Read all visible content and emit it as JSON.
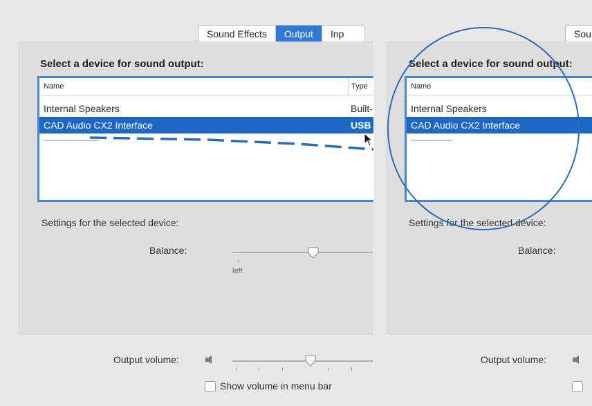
{
  "tabs": {
    "sound_effects": "Sound Effects",
    "output": "Output",
    "input_truncated": "Inp",
    "sound_truncated": "Sou"
  },
  "output_panel": {
    "heading": "Select a device for sound output:",
    "heading_right": "Select a device for sound output:",
    "columns": {
      "name": "Name",
      "type": "Type"
    },
    "devices": [
      {
        "name": "Internal Speakers",
        "type": "Built-"
      },
      {
        "name": "CAD Audio CX2 Interface",
        "type": "USB",
        "selected": true
      }
    ],
    "settings_label": "Settings for the selected device:",
    "settings_label_right": "Settings for the selected device:",
    "balance_label": "Balance:",
    "balance_left_label": "left",
    "balance_value": 0.5
  },
  "footer": {
    "output_volume_label": "Output volume:",
    "output_volume_value": 0.55,
    "show_volume_label": "Show volume in menu bar",
    "show_volume_checked": false
  },
  "colors": {
    "selection": "#1d68c4",
    "tab_active": "#2f7ad6",
    "annotation": "#2a6db3"
  },
  "icons": [
    "speaker-icon",
    "mouse-cursor-icon"
  ]
}
